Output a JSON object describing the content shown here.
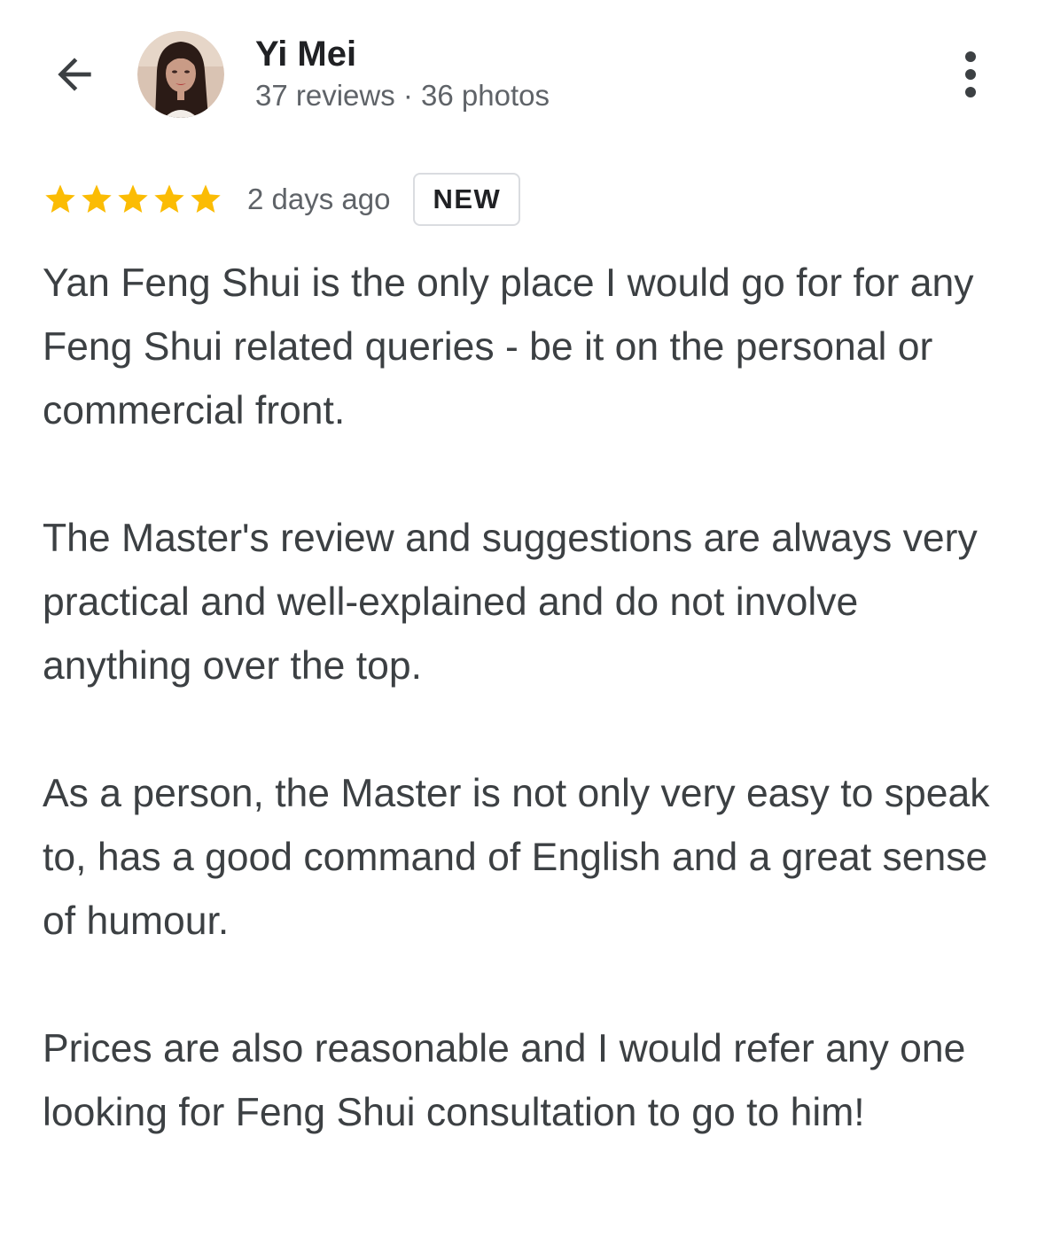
{
  "header": {
    "back_icon": "arrow-back-icon",
    "avatar_icon": "profile-photo",
    "name": "Yi Mei",
    "stats": "37 reviews · 36 photos",
    "more_icon": "more-vertical-icon"
  },
  "review": {
    "rating": 5,
    "max_rating": 5,
    "star_color": "#fbbc04",
    "time": "2 days ago",
    "badge": "NEW",
    "paragraphs": [
      "Yan Feng Shui is the only place I would go for for any Feng Shui related queries - be it on the personal or commercial front.",
      "The Master's review and suggestions are always very practical and well-explained and do not involve anything over the top.",
      "As a person, the Master is not only very easy to speak to, has a good command of English and a great sense of humour.",
      "Prices are also reasonable and I would refer any one looking for Feng Shui consultation to go to him!"
    ]
  }
}
